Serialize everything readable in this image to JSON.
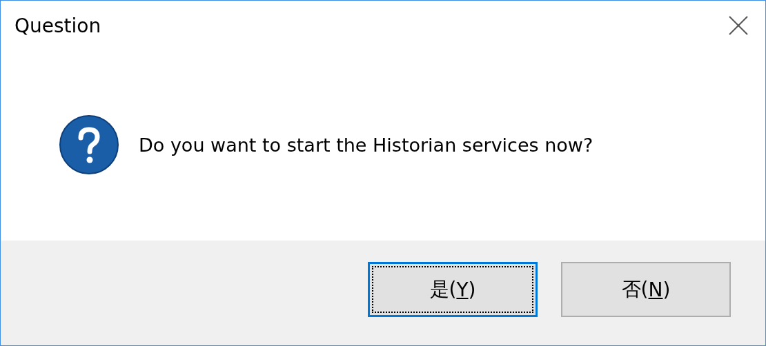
{
  "window": {
    "title": "Question"
  },
  "message": "Do you want to start the Historian services now?",
  "buttons": [
    {
      "text": "是(",
      "accesskey": "Y",
      "text_after": ")",
      "focused": true
    },
    {
      "text": "否(",
      "accesskey": "N",
      "text_after": ")",
      "focused": false
    }
  ]
}
